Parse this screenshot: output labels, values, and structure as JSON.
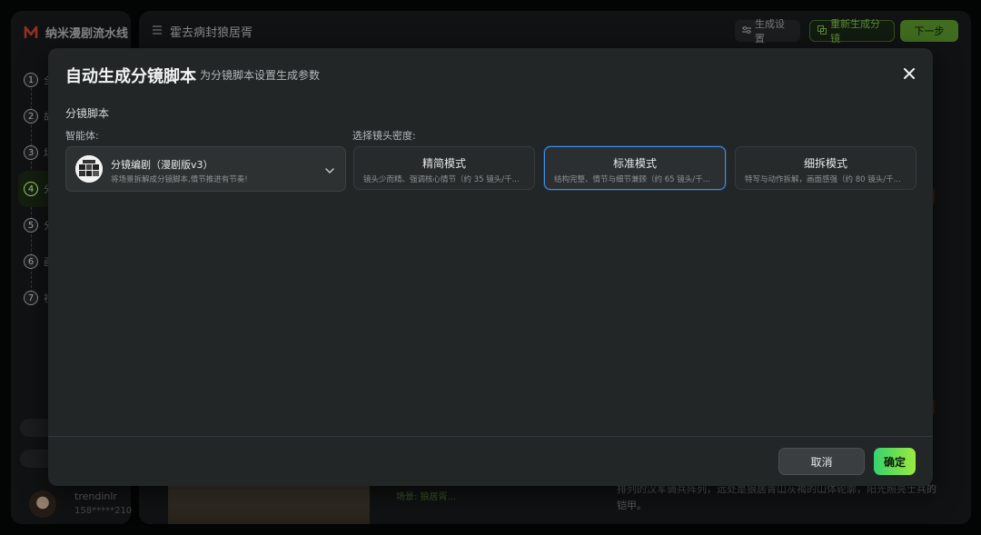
{
  "app": {
    "brand": "纳米漫剧流水线",
    "project_title": "霍去病封狼居胥"
  },
  "sidebar": {
    "steps": [
      {
        "num": "1",
        "label": "全"
      },
      {
        "num": "2",
        "label": "故"
      },
      {
        "num": "3",
        "label": "场"
      },
      {
        "num": "4",
        "label": "分"
      },
      {
        "num": "5",
        "label": "分"
      },
      {
        "num": "6",
        "label": "画"
      },
      {
        "num": "7",
        "label": "视"
      }
    ],
    "user_name": "trendinlr",
    "user_phone": "158*****210"
  },
  "header": {
    "settings_label": "生成设置",
    "regen_label": "重新生成分镜",
    "next_label": "下一步"
  },
  "background": {
    "caption": "场景: 狼居胥...",
    "text": "排列的汉军骑兵阵列，远处是狼居胥山灰褐的山体轮廓，阳光照亮士兵的铠甲。"
  },
  "modal": {
    "title": "自动生成分镜脚本",
    "subtitle": "为分镜脚本设置生成参数",
    "section_label": "分镜脚本",
    "agent_label": "智能体:",
    "density_label": "选择镜头密度:",
    "agent": {
      "name": "分镜编剧（漫剧版v3）",
      "desc": "将场景拆解成分镜脚本,情节推进有节奏!"
    },
    "modes": [
      {
        "title": "精简模式",
        "desc": "镜头少而精、强调核心情节（约 35 镜头/千...",
        "selected": false
      },
      {
        "title": "标准模式",
        "desc": "结构完整、情节与细节兼顾（约 65 镜头/千...",
        "selected": true
      },
      {
        "title": "细拆模式",
        "desc": "特写与动作拆解，画面感强（约 80 镜头/千...",
        "selected": false
      }
    ],
    "cancel_label": "取消",
    "ok_label": "确定"
  },
  "colors": {
    "accent_green": "#8bd34a",
    "selected_blue": "#3f8de8"
  }
}
